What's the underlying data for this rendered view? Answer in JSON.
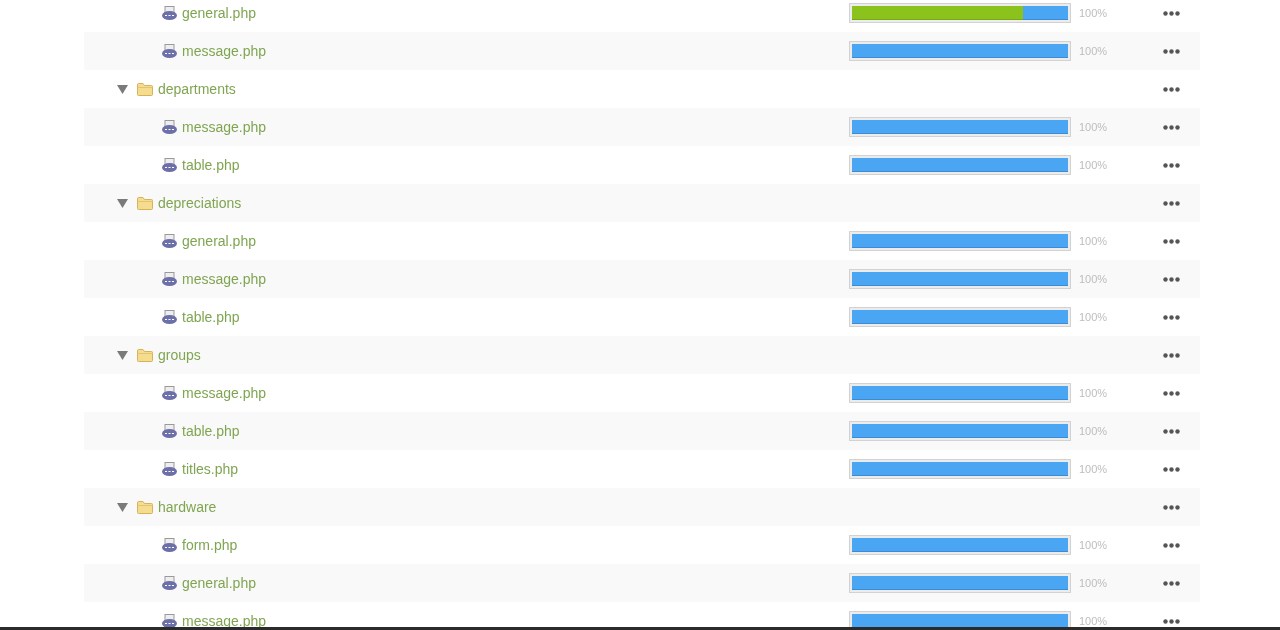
{
  "tree": [
    {
      "kind": "folder",
      "children": [
        {
          "kind": "file",
          "name": "general.php",
          "translated": {
            "level": 1
          },
          "approved": {
            "level": 0.79
          },
          "percent": "100%"
        },
        {
          "kind": "file",
          "name": "message.php",
          "translated": {
            "level": 1
          },
          "percent": "100%"
        }
      ]
    },
    {
      "kind": "folder",
      "name": "departments",
      "expanded": true,
      "children": [
        {
          "kind": "file",
          "name": "message.php",
          "translated": {
            "level": 1
          },
          "percent": "100%"
        },
        {
          "kind": "file",
          "name": "table.php",
          "translated": {
            "level": 1
          },
          "percent": "100%"
        }
      ]
    },
    {
      "kind": "folder",
      "name": "depreciations",
      "expanded": true,
      "children": [
        {
          "kind": "file",
          "name": "general.php",
          "translated": {
            "level": 1
          },
          "percent": "100%"
        },
        {
          "kind": "file",
          "name": "message.php",
          "translated": {
            "level": 1
          },
          "percent": "100%"
        },
        {
          "kind": "file",
          "name": "table.php",
          "translated": {
            "level": 1
          },
          "percent": "100%"
        }
      ]
    },
    {
      "kind": "folder",
      "name": "groups",
      "expanded": true,
      "children": [
        {
          "kind": "file",
          "name": "message.php",
          "translated": {
            "level": 1
          },
          "percent": "100%"
        },
        {
          "kind": "file",
          "name": "table.php",
          "translated": {
            "level": 1
          },
          "percent": "100%"
        },
        {
          "kind": "file",
          "name": "titles.php",
          "translated": {
            "level": 1
          },
          "percent": "100%"
        }
      ]
    },
    {
      "kind": "folder",
      "name": "hardware",
      "expanded": true,
      "children": [
        {
          "kind": "file",
          "name": "form.php",
          "translated": {
            "level": 1
          },
          "percent": "100%"
        },
        {
          "kind": "file",
          "name": "general.php",
          "translated": {
            "level": 1
          },
          "percent": "100%"
        },
        {
          "kind": "file",
          "name": "message.php",
          "translated": {
            "level": 1
          },
          "percent": "100%"
        }
      ]
    }
  ]
}
